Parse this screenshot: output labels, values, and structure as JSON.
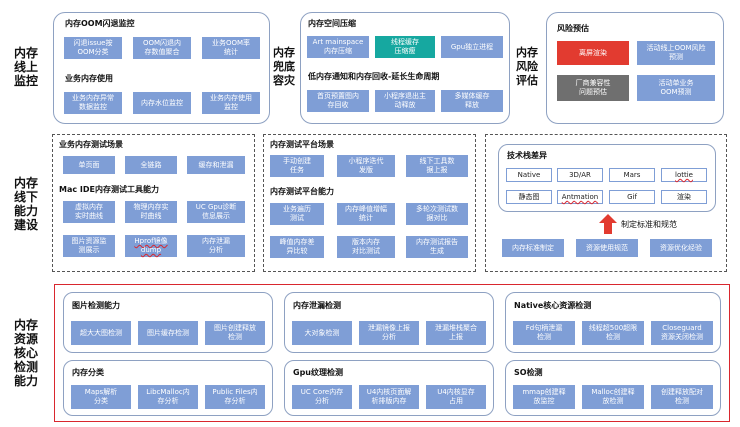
{
  "rows": {
    "online": "内存\n线上\n监控",
    "offline": "内存\n线下\n能力\n建设",
    "detection": "内存\n资源\n核心\n检测\n能力"
  },
  "row1": {
    "monitor_box": {
      "title1": "内存OOM闪退监控",
      "items1": [
        "闪退issue按\nOOM分类",
        "OOM闪退内\n存数值聚合",
        "业务OOM率\n统计"
      ],
      "title2": "业务内存使用",
      "items2": [
        "业务内存异常\n数据监控",
        "内存水位监控",
        "业务内存使用\n监控"
      ]
    },
    "fallback_label": "内存\n兜底\n容灾",
    "fallback_box": {
      "title1": "内存空间压缩",
      "items1": [
        "Art mainspace\n内存压缩",
        "线程缓存\n压缩瘦",
        "Gpu独立进程"
      ],
      "title2": "低内存通知和内存回收-延长生命周期",
      "items2": [
        "首页预置图内\n存回收",
        "小程序退出主\n动释放",
        "多媒体缓存\n释放"
      ]
    },
    "risk_label": "内存\n风险\n评估",
    "risk_box": {
      "title": "风险预估",
      "items": [
        "离屏渲染",
        "活动线上OOM风险\n预测",
        "厂商兼容性\n问题预估",
        "活动单业务\nOOM预测"
      ]
    }
  },
  "row2": {
    "test_box": {
      "title1": "业务内存测试场景",
      "items1": [
        "单页面",
        "全链路",
        "缓存和泄漏"
      ],
      "title2": "Mac IDE内存测试工具能力",
      "items2": [
        "虚拟内存\n实时曲线",
        "物理内存实\n时曲线",
        "UC Gpu诊断\n信息展示",
        "图片资源监\n测展示",
        "Hprof镜像\ndump",
        "内存泄漏\n分析"
      ]
    },
    "platform_box": {
      "title1": "内存测试平台场景",
      "items1": [
        "手动创建\n任务",
        "小程序迭代\n发版",
        "线下工具数\n据上报"
      ],
      "title2": "内存测试平台能力",
      "items2": [
        "业务遍历\n测试",
        "内存峰值增幅\n统计",
        "多轮次测试数\n据对比",
        "峰值内存差\n异比较",
        "版本内存\n对比测试",
        "内存测试报告\n生成"
      ]
    },
    "tech_box": {
      "title": "技术栈差异",
      "chips": [
        "Native",
        "3D/AR",
        "Mars",
        "lottie",
        "静态图",
        "Antmation",
        "Gif",
        "渲染"
      ],
      "arrow_label": "制定标准和规范",
      "items": [
        "内存标准制定",
        "资源使用规范",
        "资源优化经验"
      ]
    }
  },
  "row3": {
    "image": {
      "title": "图片检测能力",
      "items": [
        "超大大图检测",
        "图片缓存检测",
        "图片创建释放\n检测"
      ]
    },
    "leak": {
      "title": "内存泄漏检测",
      "items": [
        "大对象检测",
        "泄漏镜像上报\n分析",
        "泄漏堆栈聚合\n上报"
      ]
    },
    "native": {
      "title": "Native核心资源检测",
      "items": [
        "Fd句柄泄漏\n检测",
        "线程超500超限\n检测",
        "Closeguard\n资源关闭检测"
      ]
    },
    "classify": {
      "title": "内存分类",
      "items": [
        "Maps解析\n分类",
        "LibcMalloc内\n存分析",
        "Public Files内\n存分析"
      ]
    },
    "gpu": {
      "title": "Gpu纹理检测",
      "items": [
        "UC Core内存\n分析",
        "U4内核页面解\n析排版内存",
        "U4内核显存\n占用"
      ]
    },
    "so": {
      "title": "SO检测",
      "items": [
        "mmap创建释\n放监控",
        "Malloc创建释\n放检测",
        "创建释放配对\n检测"
      ]
    }
  },
  "colors": {
    "button": "#7f9ed6",
    "highlight_teal": "#16a8a0",
    "highlight_red": "#e23b30",
    "highlight_gray": "#6f6f6f",
    "frame_red": "#d9272e"
  }
}
